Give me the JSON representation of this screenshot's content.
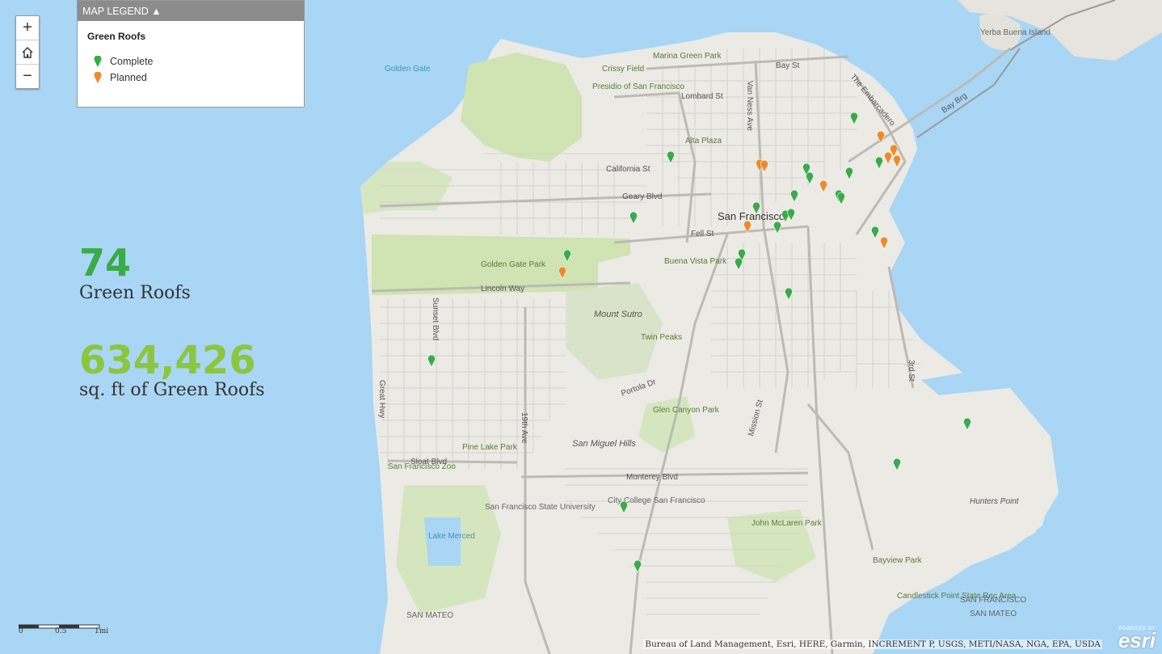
{
  "zoom": {
    "in": "+",
    "out": "−",
    "home_icon": "home-icon"
  },
  "legend": {
    "header": "MAP LEGEND ▲",
    "layer_title": "Green Roofs",
    "items": [
      {
        "label": "Complete",
        "color": "#3aab49"
      },
      {
        "label": "Planned",
        "color": "#f0892a"
      }
    ]
  },
  "stats": {
    "count_value": "74",
    "count_label": "Green Roofs",
    "area_value": "634,426",
    "area_label": "sq. ft of Green Roofs",
    "count_color": "#3aab49",
    "area_color": "#8cc63f"
  },
  "scale": {
    "t0": "0",
    "t1": "0.5",
    "t2": "1mi"
  },
  "attribution": "Bureau of Land Management, Esri, HERE, Garmin, INCREMENT P, USGS, METI/NASA, NGA, EPA, USDA",
  "esri": {
    "powered": "POWERED BY",
    "logo": "esri"
  },
  "map_labels": {
    "golden_gate": "Golden Gate",
    "yerba_buena": "Yerba Buena Island",
    "san_francisco": "San Francisco",
    "geary": "Geary Blvd",
    "lincoln": "Lincoln Way",
    "sloat": "Sloat Blvd",
    "monterey": "Monterey Blvd",
    "mount_sutro": "Mount Sutro",
    "san_miguel": "San Miguel Hills",
    "golden_gate_park": "Golden Gate Park",
    "presidio": "Presidio of San Francisco",
    "crissy": "Crissy Field",
    "marina": "Marina Green Park",
    "hunters": "Hunters Point",
    "candlestick": "Candlestick Point State Rec Area",
    "san_francisco_bottom": "SAN FRANCISCO",
    "san_mateo": "SAN MATEO",
    "san_mateo_left": "SAN MATEO",
    "lake_merced": "Lake Merced",
    "sf_zoo": "San Francisco Zoo",
    "sf_state": "San Francisco State University",
    "city_college": "City College San Francisco",
    "mclaren": "John McLaren Park",
    "bayview": "Bayview Park",
    "embarcadero": "The Embarcadero",
    "bay_bridge": "Bay Brg",
    "twin_peaks": "Twin Peaks",
    "lombard": "Lombard St",
    "bay_st": "Bay St",
    "california": "California St",
    "fell": "Fell St",
    "van_ness": "Van Ness Ave",
    "mission": "Mission St",
    "third": "3rd St",
    "portola": "Portola Dr",
    "alta_plaza": "Alta Plaza",
    "buena_vista": "Buena Vista Park",
    "glen_canyon": "Glen Canyon Park",
    "pine_lake": "Pine Lake Park",
    "great_hwy": "Great Hwy",
    "nineteenth": "19th Ave",
    "sunset": "Sunset Blvd"
  },
  "markers": {
    "complete": [
      [
        1057,
        149
      ],
      [
        830,
        197
      ],
      [
        1088,
        204
      ],
      [
        1051,
        217
      ],
      [
        998,
        212
      ],
      [
        1002,
        223
      ],
      [
        1038,
        245
      ],
      [
        1041,
        248
      ],
      [
        983,
        245
      ],
      [
        936,
        260
      ],
      [
        972,
        270
      ],
      [
        979,
        268
      ],
      [
        962,
        284
      ],
      [
        1083,
        290
      ],
      [
        784,
        272
      ],
      [
        702,
        319
      ],
      [
        918,
        318
      ],
      [
        914,
        329
      ],
      [
        976,
        366
      ],
      [
        534,
        449
      ],
      [
        1197,
        527
      ],
      [
        1110,
        577
      ],
      [
        772,
        630
      ],
      [
        789,
        703
      ]
    ],
    "planned": [
      [
        1090,
        172
      ],
      [
        1106,
        189
      ],
      [
        1099,
        198
      ],
      [
        1110,
        202
      ],
      [
        940,
        207
      ],
      [
        946,
        208
      ],
      [
        1019,
        233
      ],
      [
        925,
        283
      ],
      [
        1094,
        303
      ],
      [
        696,
        340
      ]
    ]
  }
}
